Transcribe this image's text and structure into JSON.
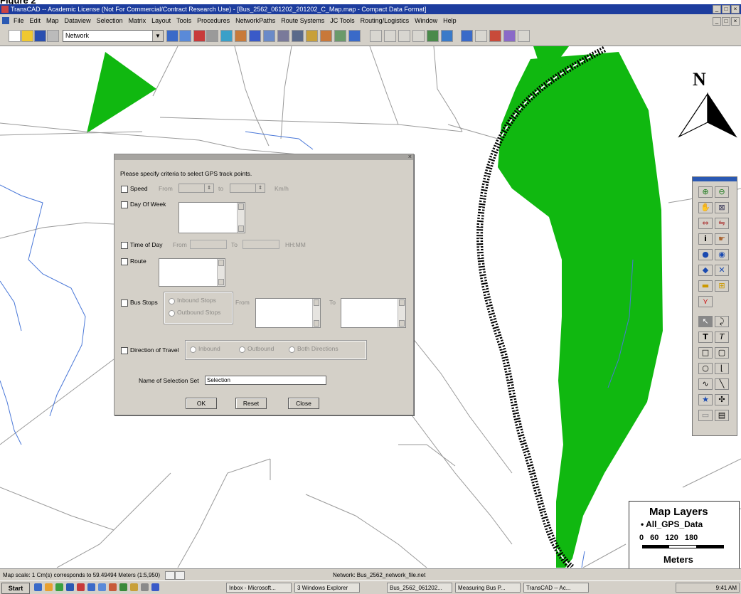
{
  "figure_caption": "Figure 2",
  "app": {
    "title": "TransCAD -- Academic License (Not For Commercial/Contract Research Use) - [Bus_2562_061202_201202_C_Map.map - Compact Data Format]"
  },
  "menu": [
    "File",
    "Edit",
    "Map",
    "Dataview",
    "Selection",
    "Matrix",
    "Layout",
    "Tools",
    "Procedures",
    "NetworkPaths",
    "Route Systems",
    "JC Tools",
    "Routing/Logistics",
    "Window",
    "Help"
  ],
  "toolbar": {
    "layer_select": "Network"
  },
  "dialog": {
    "instruction": "Please specify criteria to select GPS track points.",
    "speed_label": "Speed",
    "from_label": "From",
    "to_label": "to",
    "speed_units": "Km/h",
    "day_of_week_label": "Day Of Week",
    "time_of_day_label": "Time of Day",
    "time_from": "From",
    "time_to": "To",
    "time_units": "HH:MM",
    "route_label": "Route",
    "bus_stops_label": "Bus Stops",
    "stops_opt1": "Inbound Stops",
    "stops_opt2": "Outbound Stops",
    "stops_from": "From",
    "stops_to": "To",
    "direction_label": "Direction of Travel",
    "dir_opt1": "Inbound",
    "dir_opt2": "Outbound",
    "dir_opt3": "Both Directions",
    "selection_set_label": "Name of Selection Set",
    "selection_set_value": "Selection",
    "ok_label": "OK",
    "reset_label": "Reset",
    "close_label": "Close"
  },
  "legend": {
    "title": "Map Layers",
    "item": "All_GPS_Data",
    "scale_ticks": "0 60 120 180",
    "units": "Meters"
  },
  "north_label": "N",
  "status": {
    "left": "Map scale: 1 Cm(s) corresponds to 59.49494 Meters (1:5,950)",
    "network": "Network: Bus_2562_network_file.net"
  },
  "taskbar": {
    "start": "Start",
    "tasks": [
      "Inbox - Microsoft...",
      "3 Windows Explorer",
      "Bus_2562_061202...",
      "Measuring Bus P...",
      "TransCAD -- Ac..."
    ],
    "clock": "9:41 AM"
  },
  "colors": {
    "park": "#10b810",
    "title_bar": "#1d3d9e",
    "face": "#d4d0c8",
    "water": "#4a78d8",
    "road": "#9a9a9a"
  }
}
